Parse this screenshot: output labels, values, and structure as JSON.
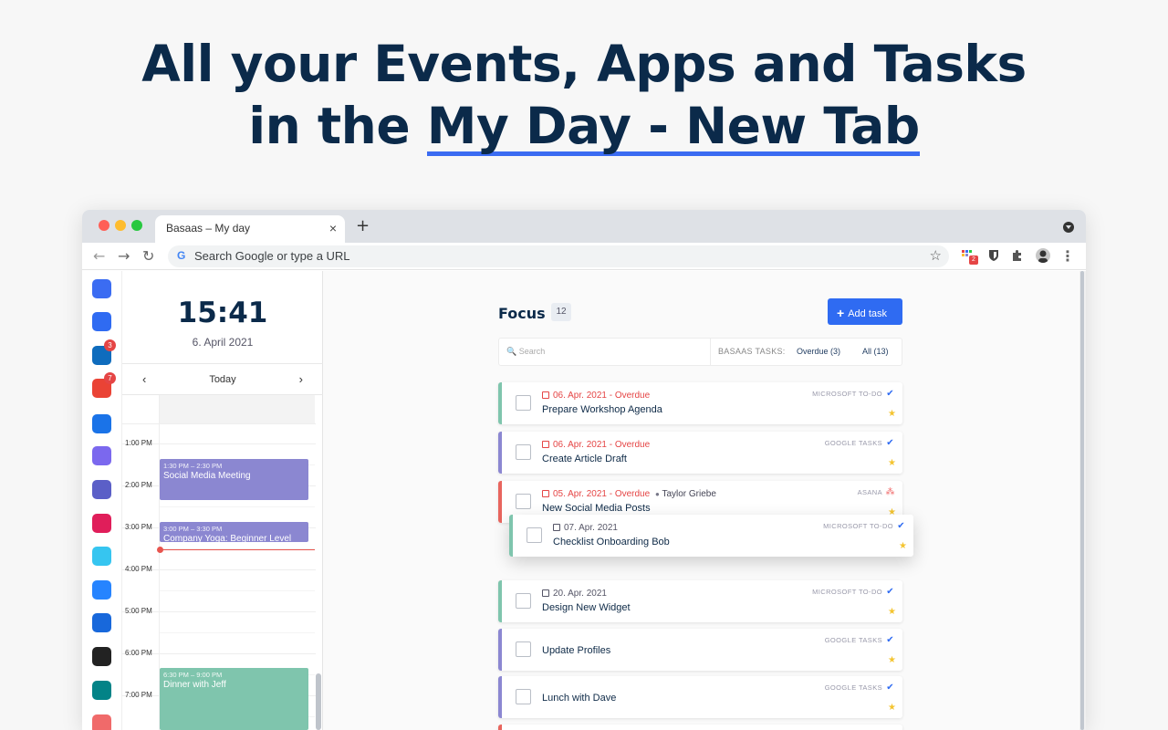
{
  "headline": {
    "line1": "All your Events, Apps and Tasks",
    "line2_prefix": "in the ",
    "line2_highlight": "My Day - New Tab"
  },
  "browser": {
    "tab_title": "Basaas – My day",
    "tab_close": "×",
    "new_tab": "+",
    "address_placeholder": "Search Google or type a URL",
    "google_g": "G",
    "bookmark_star": "☆",
    "back": "←",
    "forward": "→",
    "reload": "↻",
    "menu": "⋮",
    "ext_badge": "2"
  },
  "apps": [
    {
      "name": "basaas-apps",
      "color": "#3b6cf2"
    },
    {
      "name": "basaas-tasks",
      "color": "#2f6bf2"
    },
    {
      "name": "outlook",
      "color": "#0f6cbd",
      "badge": "3"
    },
    {
      "name": "gmail",
      "color": "#ea4335",
      "badge": "7"
    },
    {
      "name": "google-calendar",
      "color": "#1a73e8"
    },
    {
      "name": "clickup",
      "color": "#7b68ee"
    },
    {
      "name": "teams",
      "color": "#5b5fc7"
    },
    {
      "name": "slack",
      "color": "#e01e5a"
    },
    {
      "name": "slack-2",
      "color": "#36c5f0"
    },
    {
      "name": "jira",
      "color": "#2684ff"
    },
    {
      "name": "confluence",
      "color": "#1868db"
    },
    {
      "name": "notion",
      "color": "#222222"
    },
    {
      "name": "sharepoint",
      "color": "#038387"
    },
    {
      "name": "asana",
      "color": "#f06a6a"
    }
  ],
  "calendar": {
    "time": "15:41",
    "date": "6. April 2021",
    "today_label": "Today",
    "prev": "‹",
    "next": "›",
    "hours": [
      "1:00 PM",
      "2:00 PM",
      "3:00 PM",
      "4:00 PM",
      "5:00 PM",
      "6:00 PM",
      "7:00 PM"
    ],
    "events": [
      {
        "time": "1:30 PM – 2:30 PM",
        "title": "Social Media Meeting",
        "color": "#8b87d1"
      },
      {
        "time": "3:00 PM – 3:30 PM",
        "title": "Company Yoga: Beginner Level",
        "color": "#8b87d1"
      },
      {
        "time": "6:30 PM – 9:00 PM",
        "title": "Dinner with Jeff",
        "color": "#7fc5ad"
      }
    ]
  },
  "focus": {
    "title": "Focus",
    "count": "12",
    "add_task": "Add task",
    "add_plus": "+",
    "search_placeholder": "Search",
    "filter_label": "BASAAS TASKS:",
    "filter_overdue": "Overdue (3)",
    "filter_all": "All (13)"
  },
  "tasks": [
    {
      "due": "06. Apr. 2021 - Overdue",
      "overdue": true,
      "name": "Prepare Workshop Agenda",
      "source": "MICROSOFT TO-DO",
      "source_icon": "✔",
      "bar": "#7fc5ad",
      "icon_color": "#2f6bf2"
    },
    {
      "due": "06. Apr. 2021 - Overdue",
      "overdue": true,
      "name": "Create Article Draft",
      "source": "GOOGLE TASKS",
      "source_icon": "✔",
      "bar": "#8b87d1",
      "icon_color": "#2f6bf2"
    },
    {
      "due": "05. Apr. 2021 - Overdue",
      "overdue": true,
      "assignee": "Taylor Griebe",
      "name": "New Social Media Posts",
      "source": "ASANA",
      "source_icon": "⁂",
      "bar": "#e8655e",
      "icon_color": "#f06a6a"
    },
    {
      "due": "07. Apr. 2021",
      "overdue": false,
      "name": "Checklist Onboarding Bob",
      "source": "MICROSOFT TO-DO",
      "source_icon": "✔",
      "bar": "#7fc5ad",
      "icon_color": "#2f6bf2"
    },
    {
      "due": "20. Apr. 2021",
      "overdue": false,
      "name": "Design New Widget",
      "source": "MICROSOFT TO-DO",
      "source_icon": "✔",
      "bar": "#7fc5ad",
      "icon_color": "#2f6bf2"
    },
    {
      "due": "",
      "overdue": false,
      "name": "Update Profiles",
      "source": "GOOGLE TASKS",
      "source_icon": "✔",
      "bar": "#8b87d1",
      "icon_color": "#2f6bf2"
    },
    {
      "due": "",
      "overdue": false,
      "name": "Lunch with Dave",
      "source": "GOOGLE TASKS",
      "source_icon": "✔",
      "bar": "#8b87d1",
      "icon_color": "#2f6bf2"
    }
  ],
  "star_glyph": "★",
  "person_glyph": "👤"
}
